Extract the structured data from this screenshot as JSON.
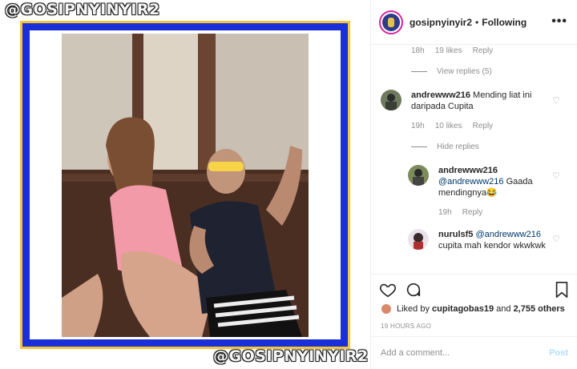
{
  "media": {
    "watermark_top": "@GOSIPNYINYIR2",
    "watermark_bottom": "@GOSIPNYINYIR2",
    "frame_colors": {
      "gold": "#f2c53a",
      "blue": "#1b2fd8"
    }
  },
  "header": {
    "username": "gosipnyinyir2",
    "separator": "•",
    "follow_status": "Following",
    "more_icon": "ellipsis-icon"
  },
  "comments": {
    "top_meta": {
      "time": "18h",
      "likes": "19 likes",
      "reply": "Reply"
    },
    "view_replies": "View replies (5)",
    "items": [
      {
        "username": "andrewww216",
        "text": "Mending liat ini daripada Cupita",
        "time": "19h",
        "likes": "10 likes",
        "reply": "Reply",
        "toggle_replies": "Hide replies"
      }
    ],
    "replies": [
      {
        "username": "andrewww216",
        "mention": "@andrewww216",
        "text": "Gaada mendingnya😂",
        "time": "19h",
        "reply": "Reply"
      },
      {
        "username": "nurulsf5",
        "mention": "@andrewww216",
        "text": "cupita mah kendor wkwkwk"
      }
    ]
  },
  "actions": {
    "like_icon": "heart-icon",
    "comment_icon": "speech-bubble-icon",
    "save_icon": "bookmark-icon",
    "liked_by_prefix": "Liked by",
    "liked_by_user": "cupitagobas19",
    "liked_by_and": "and",
    "liked_by_others": "2,755 others",
    "timestamp": "19 HOURS AGO"
  },
  "comment_box": {
    "placeholder": "Add a comment...",
    "post_label": "Post"
  }
}
